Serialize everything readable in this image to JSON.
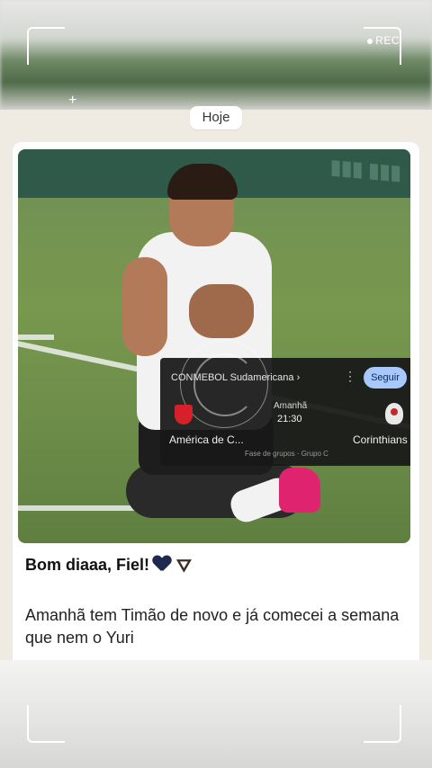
{
  "camera": {
    "rec_label": "REC"
  },
  "chat": {
    "date_chip": "Hoje"
  },
  "score_card": {
    "league": "CONMEBOL Sudamericana ›",
    "follow_label": "Seguir",
    "when": "Amanhã",
    "time": "21:30",
    "home_team": "América de C...",
    "away_team": "Corinthians",
    "phase": "Fase de grupos · Grupo C",
    "menu_icon": "more-vert-icon"
  },
  "message": {
    "title": "Bom diaaa, Fiel!",
    "body": "Amanhã tem Timão de novo e já comecei a semana que nem o Yuri"
  },
  "colors": {
    "chat_background": "#efeae2",
    "follow_button": "#a8c7fa",
    "card_background": "#181818"
  }
}
